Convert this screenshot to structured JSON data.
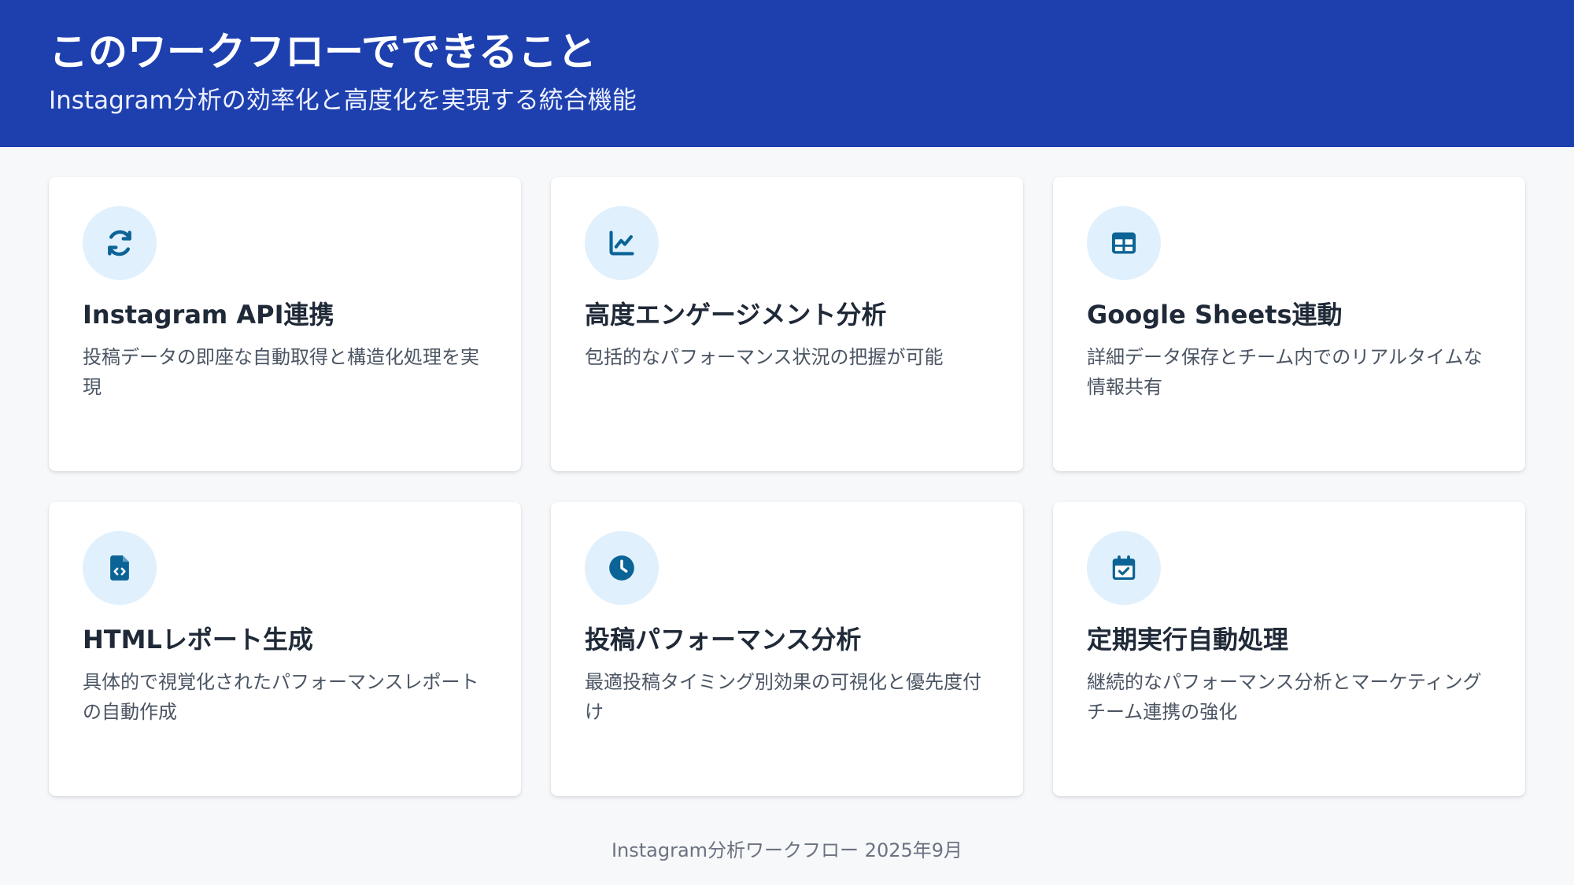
{
  "header": {
    "title": "このワークフローでできること",
    "subtitle": "Instagram分析の効率化と高度化を実現する統合機能"
  },
  "colors": {
    "header_bg": "#1e40af",
    "icon_bg": "#e0f0fd",
    "icon_fg": "#0b6396",
    "page_bg": "#f6f8fa"
  },
  "cards": [
    {
      "icon": "sync-icon",
      "title": "Instagram API連携",
      "description": "投稿データの即座な自動取得と構造化処理を実現"
    },
    {
      "icon": "line-chart-icon",
      "title": "高度エンゲージメント分析",
      "description": "包括的なパフォーマンス状況の把握が可能"
    },
    {
      "icon": "table-icon",
      "title": "Google Sheets連動",
      "description": "詳細データ保存とチーム内でのリアルタイムな情報共有"
    },
    {
      "icon": "file-code-icon",
      "title": "HTMLレポート生成",
      "description": "具体的で視覚化されたパフォーマンスレポートの自動作成"
    },
    {
      "icon": "clock-icon",
      "title": "投稿パフォーマンス分析",
      "description": "最適投稿タイミング別効果の可視化と優先度付け"
    },
    {
      "icon": "calendar-check-icon",
      "title": "定期実行自動処理",
      "description": "継続的なパフォーマンス分析とマーケティングチーム連携の強化"
    }
  ],
  "footer": {
    "text": "Instagram分析ワークフロー 2025年9月"
  }
}
